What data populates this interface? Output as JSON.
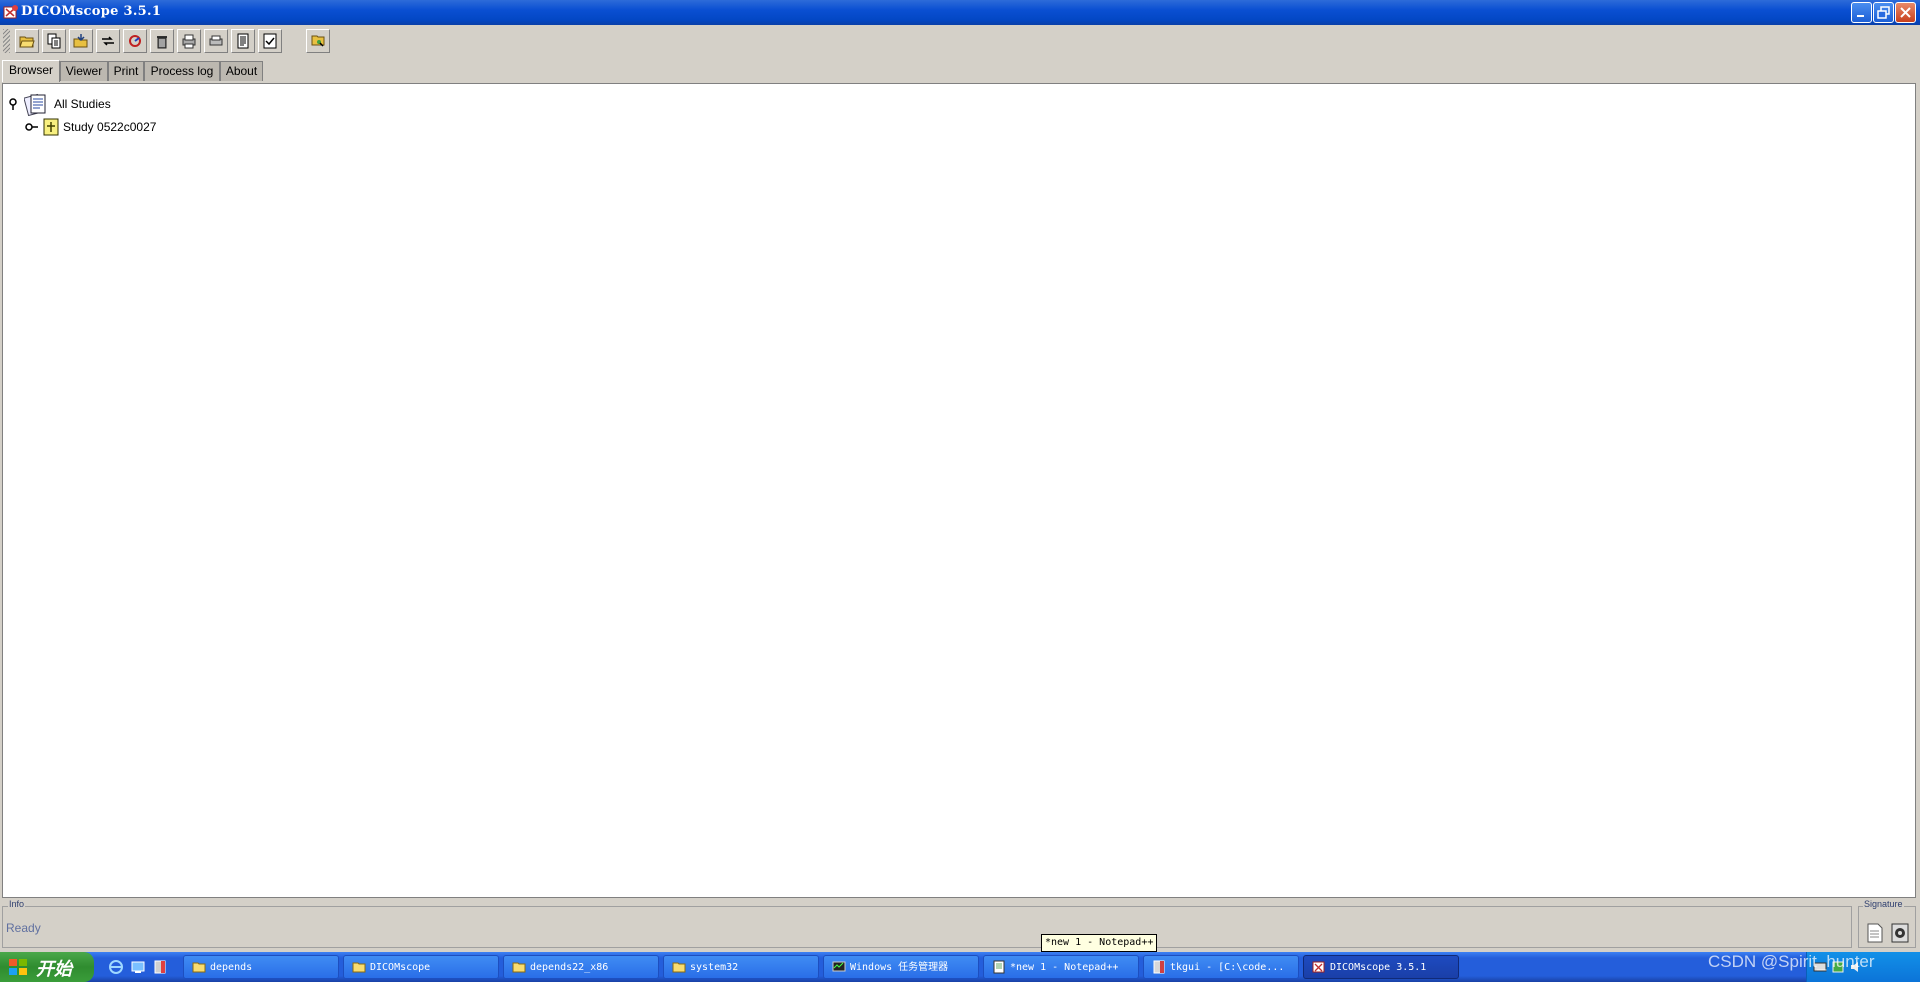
{
  "window": {
    "title": "DICOMscope 3.5.1"
  },
  "toolbar": {
    "buttons": [
      {
        "icon": "open-folder-icon"
      },
      {
        "icon": "copy-icon"
      },
      {
        "icon": "import-folder-icon"
      },
      {
        "icon": "send-arrow-icon"
      },
      {
        "icon": "refresh-icon"
      },
      {
        "icon": "trash-icon"
      },
      {
        "icon": "print-image-icon"
      },
      {
        "icon": "printer-icon"
      },
      {
        "icon": "document-icon"
      },
      {
        "icon": "checklist-icon"
      },
      {
        "icon": "query-icon"
      }
    ]
  },
  "tabs": [
    "Browser",
    "Viewer",
    "Print",
    "Process log",
    "About"
  ],
  "active_tab": "Browser",
  "tree": {
    "root_label": "All Studies",
    "items": [
      {
        "label": "Study 0522c0027"
      }
    ]
  },
  "info": {
    "legend": "Info",
    "status": "Ready"
  },
  "signature": {
    "legend": "Signature"
  },
  "taskbar": {
    "start_label": "开始",
    "tasks": [
      {
        "label": "depends",
        "icon": "folder-icon"
      },
      {
        "label": "DICOMscope",
        "icon": "folder-icon"
      },
      {
        "label": "depends22_x86",
        "icon": "folder-icon"
      },
      {
        "label": "system32",
        "icon": "folder-icon"
      },
      {
        "label": "Windows 任务管理器",
        "icon": "task-manager-icon"
      },
      {
        "label": "*new 1 - Notepad++",
        "icon": "notepad-icon"
      },
      {
        "label": "tkgui - [C:\\code...",
        "icon": "app-icon"
      },
      {
        "label": "DICOMscope 3.5.1",
        "icon": "dicomscope-icon"
      }
    ],
    "active_task": "DICOMscope 3.5.1",
    "tooltip": "*new 1 - Notepad++"
  },
  "watermark": "CSDN @Spirit_hunter",
  "colors": {
    "titlebar": "#0a4fd2",
    "taskbar": "#245edb",
    "start_button": "#2f8c2f",
    "status_text": "#6070a0"
  }
}
